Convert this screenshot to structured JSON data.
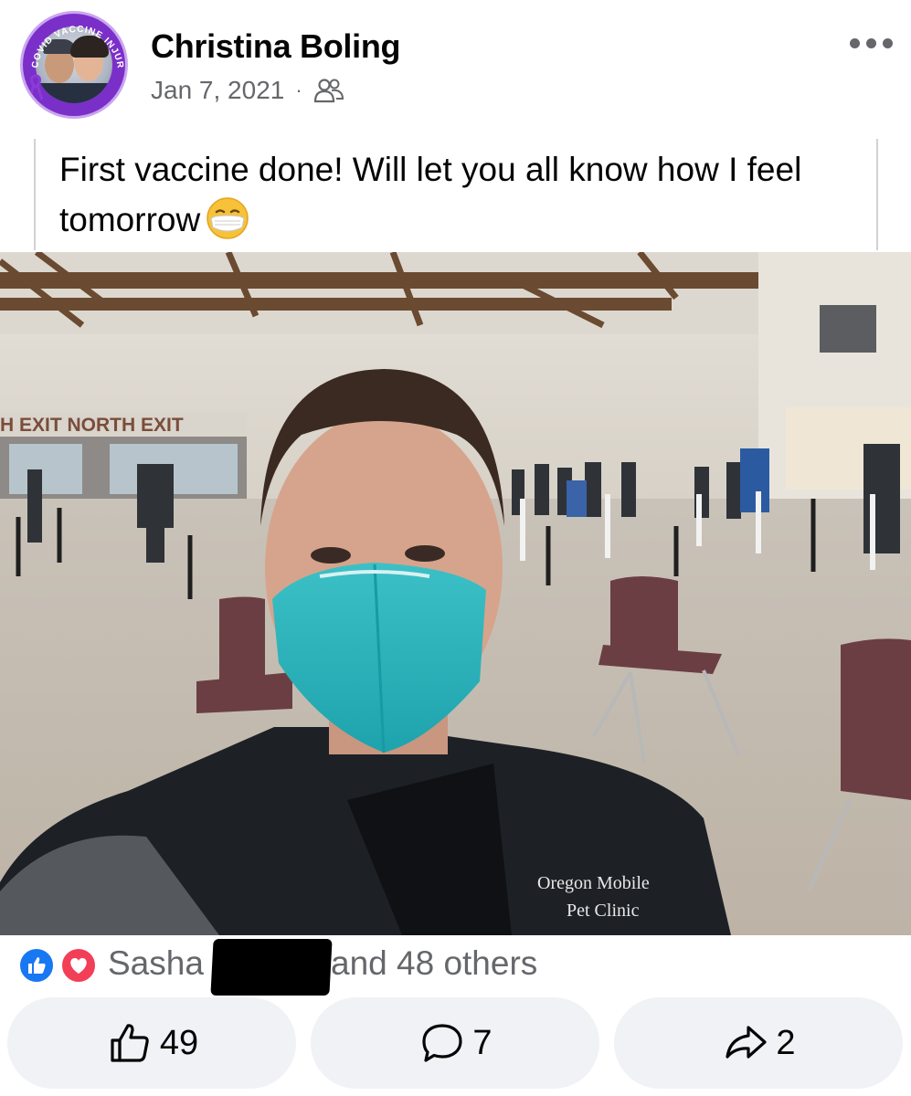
{
  "author": {
    "name": "Christina Boling"
  },
  "avatar": {
    "ring_text": "COVID VACCINE INJURED",
    "ring_color": "#7b2fc9"
  },
  "meta": {
    "date": "Jan 7, 2021",
    "separator": "·",
    "audience_icon": "friends-icon"
  },
  "post": {
    "text": "First vaccine done!  Will let you all know how I feel tomorrow",
    "emoji": "face-with-medical-mask"
  },
  "photo": {
    "wall_signs": "H EXIT NORTH EXIT",
    "vest_logo_line1": "Oregon Mobile",
    "vest_logo_line2": "Pet Clinic"
  },
  "reactions": {
    "names_prefix": "Sasha",
    "others": "and 48 others",
    "icons": [
      "like-icon",
      "love-icon"
    ],
    "like_color": "#1877f2",
    "love_color": "#f33e58"
  },
  "actions": {
    "like_count": "49",
    "comment_count": "7",
    "share_count": "2"
  }
}
